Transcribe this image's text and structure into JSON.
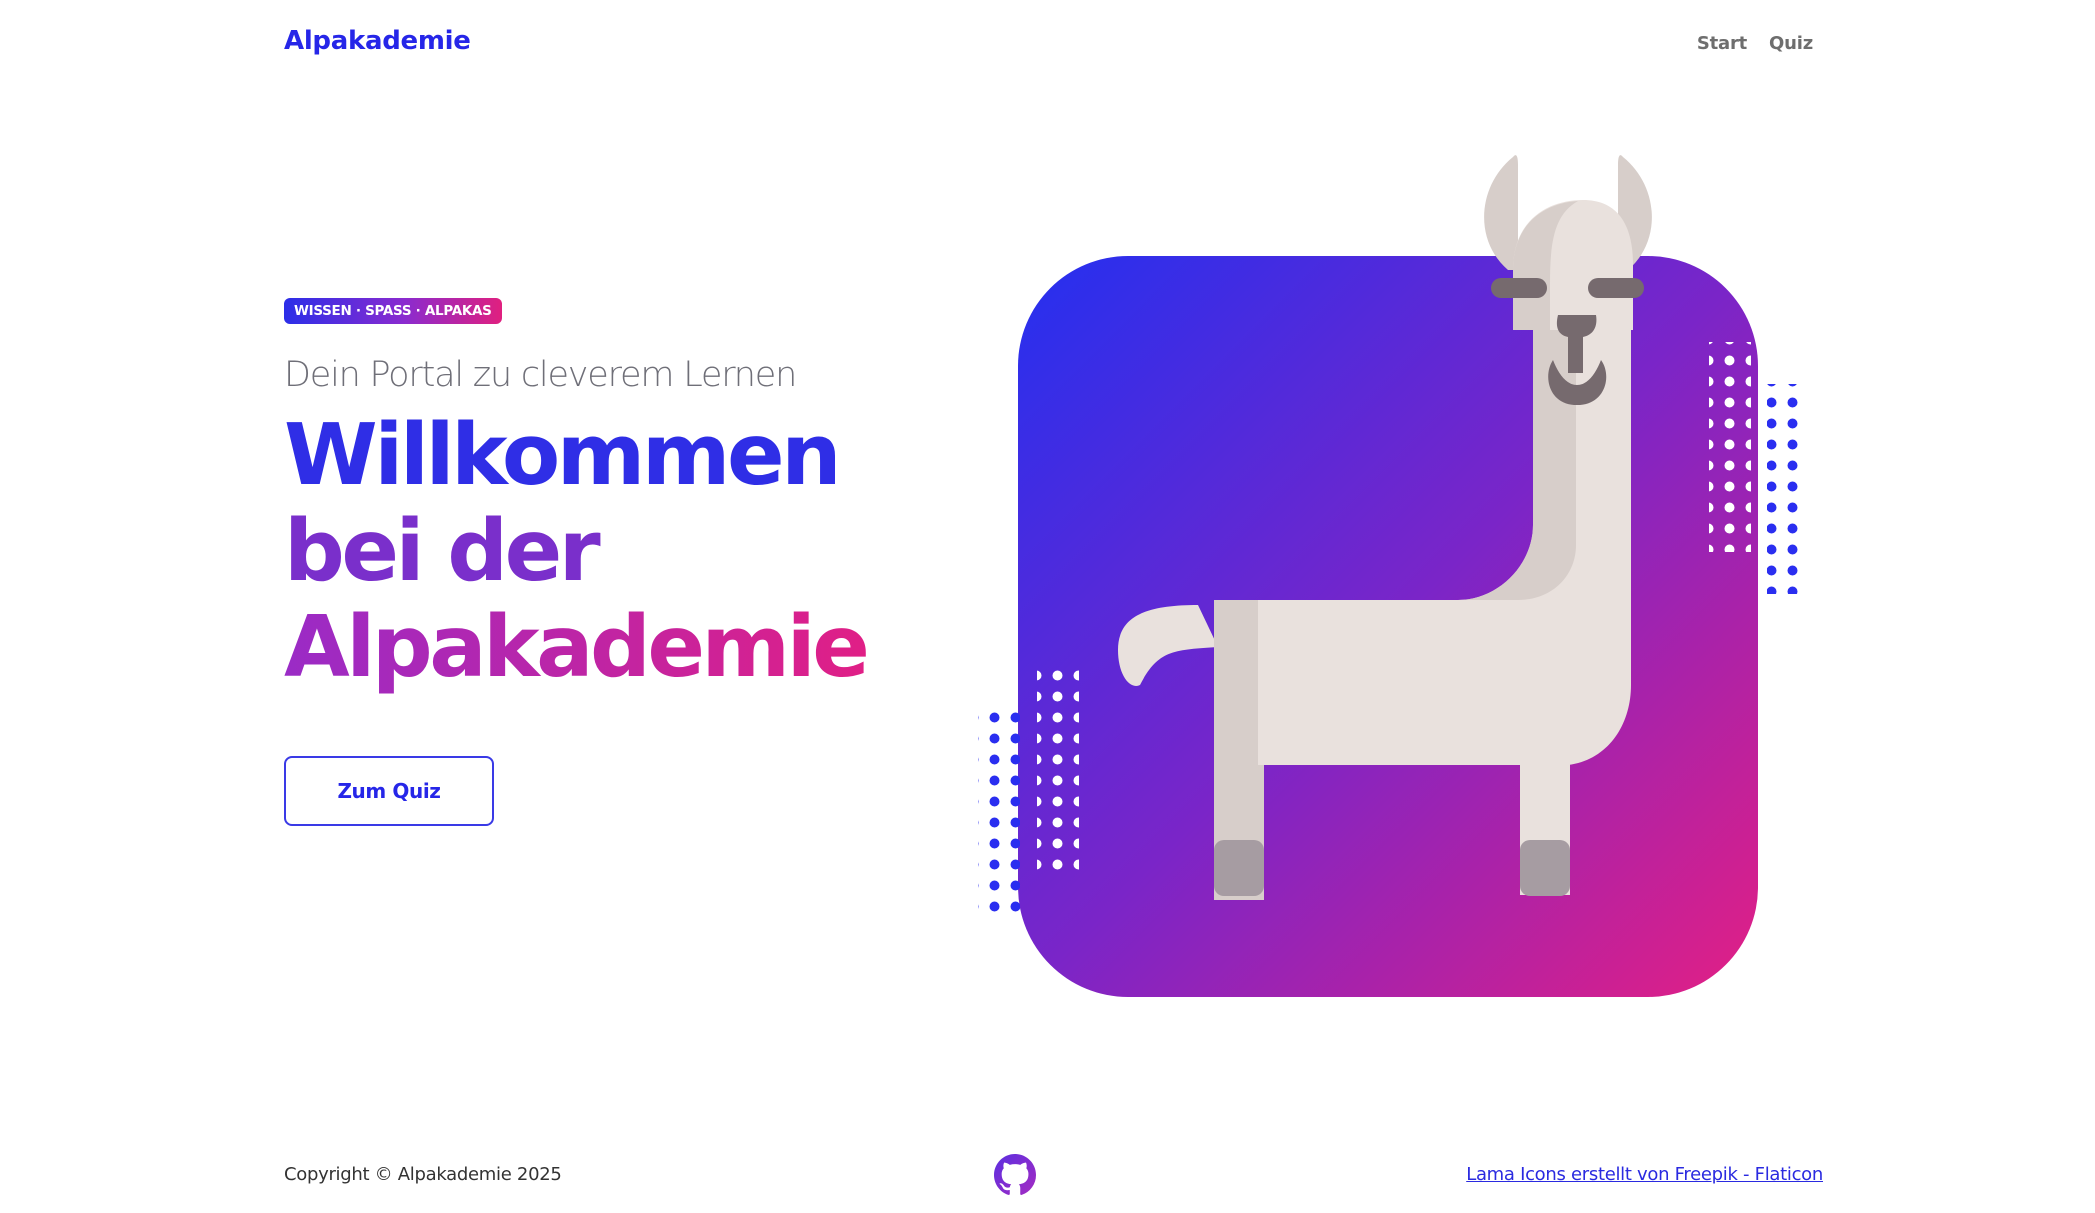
{
  "header": {
    "brand": "Alpakademie",
    "nav": [
      {
        "label": "Start"
      },
      {
        "label": "Quiz"
      }
    ]
  },
  "hero": {
    "badge": "WISSEN · SPASS · ALPAKAS",
    "subtitle": "Dein Portal zu cleverem Lernen",
    "headline": {
      "line1": "Willkommen",
      "line2": "bei der",
      "line3": "Alpakademie"
    },
    "cta_label": "Zum Quiz",
    "illustration": "llama-icon"
  },
  "footer": {
    "copyright": "Copyright © Alpakademie 2025",
    "github_icon": "github-icon",
    "credit": "Lama Icons erstellt von Freepik - Flaticon"
  },
  "colors": {
    "brand_blue": "#2626e8",
    "gradient_start": "#2b2ee8",
    "gradient_mid": "#7a2fcb",
    "gradient_end": "#e01f86",
    "llama_body": "#e9e1dd",
    "llama_shade": "#d7ceca",
    "llama_dark": "#766a6e",
    "hoof": "#a69ca2"
  }
}
